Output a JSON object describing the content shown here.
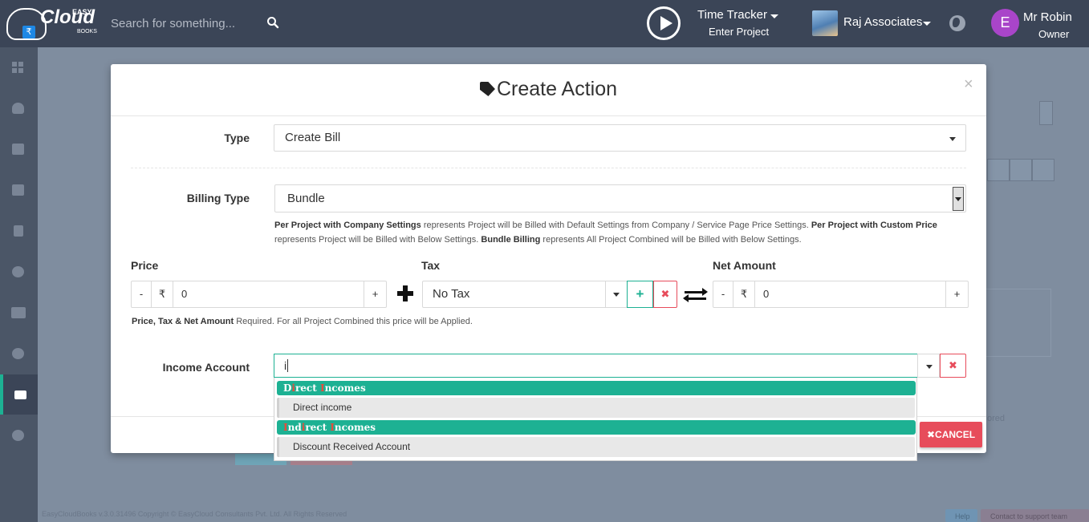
{
  "header": {
    "logo": {
      "brand": "Cloud",
      "easy": "EASY",
      "books": "BOOKS",
      "currency": "₹"
    },
    "search": {
      "placeholder": "Search for something..."
    },
    "time_tracker": {
      "title": "Time Tracker",
      "subtitle": "Enter Project"
    },
    "company": {
      "name": "Raj Associates"
    },
    "user": {
      "initial": "E",
      "name": "Mr Robin",
      "role": "Owner"
    }
  },
  "sidebar": {
    "items": [
      {
        "icon": "dashboard-icon"
      },
      {
        "icon": "user-icon"
      },
      {
        "icon": "bank-icon"
      },
      {
        "icon": "briefcase-icon"
      },
      {
        "icon": "document-icon"
      },
      {
        "icon": "clock-icon"
      },
      {
        "icon": "newspaper-icon"
      },
      {
        "icon": "plus-circle-icon"
      },
      {
        "icon": "envelope-icon",
        "active": true
      },
      {
        "icon": "gear-icon"
      }
    ]
  },
  "modal": {
    "title": "Create Action",
    "close": "×",
    "type": {
      "label": "Type",
      "value": "Create Bill"
    },
    "billing_type": {
      "label": "Billing Type",
      "value": "Bundle"
    },
    "help": {
      "b1": "Per Project with Company Settings",
      "t1": " represents Project will be Billed with Default Settings from Company / Service Page Price Settings. ",
      "b2": "Per Project with Custom Price",
      "t2": " represents Project will be Billed with Below Settings. ",
      "b3": "Bundle Billing",
      "t3": " represents All Project Combined will be Billed with Below Settings."
    },
    "price": {
      "label": "Price",
      "minus": "-",
      "currency": "₹",
      "value": "0",
      "plus": "+"
    },
    "tax": {
      "label": "Tax",
      "value": "No Tax",
      "add": "+",
      "remove": "✖"
    },
    "net_amount": {
      "label": "Net Amount",
      "minus": "-",
      "currency": "₹",
      "value": "0",
      "plus": "+"
    },
    "required_note": {
      "bold": "Price, Tax & Net Amount",
      "text": " Required. For all Project Combined this price will be Applied."
    },
    "income_account": {
      "label": "Income Account",
      "value": "i",
      "clear": "✖"
    },
    "cancel_label": "CANCEL",
    "cancel_icon": "✖"
  },
  "dropdown": {
    "groups": [
      {
        "parts": [
          "D",
          "i",
          "rect ",
          "I",
          "ncomes"
        ],
        "option": "Direct income"
      },
      {
        "parts": [
          "",
          "I",
          "nd",
          "i",
          "rect ",
          "I",
          "ncomes"
        ],
        "option": "Discount Received Account"
      }
    ]
  },
  "background": {
    "stored_text": "ored",
    "footer": "EasyCloudBooks  v.3.0.31496  Copyright © EasyCloud Consultants Pvt. Ltd. All Rights Reserved",
    "help_label": "Help",
    "support_label": "Contact to support team"
  }
}
